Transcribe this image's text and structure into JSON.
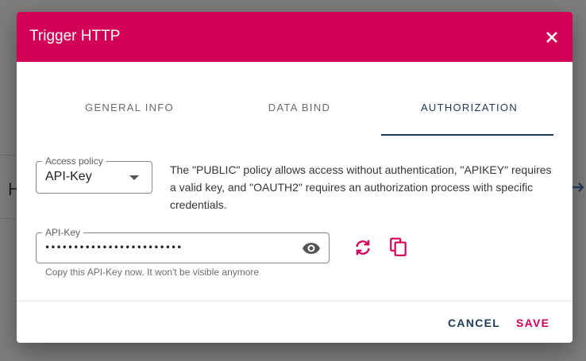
{
  "dialog": {
    "title": "Trigger HTTP"
  },
  "tabs": [
    {
      "label": "GENERAL INFO",
      "active": false
    },
    {
      "label": "DATA BIND",
      "active": false
    },
    {
      "label": "AUTHORIZATION",
      "active": true
    }
  ],
  "access_policy": {
    "label": "Access policy",
    "value": "API-Key",
    "description": "The \"PUBLIC\" policy allows access without authentication, \"APIKEY\" requires a valid key, and \"OAUTH2\" requires an authorization process with specific credentials."
  },
  "api_key": {
    "label": "API-Key",
    "value": "••••••••••••••••••••••••",
    "hint": "Copy this API-Key now. It won't be visible anymore"
  },
  "footer": {
    "cancel_label": "CANCEL",
    "save_label": "SAVE"
  },
  "background": {
    "letter": "H"
  },
  "icons": {
    "close": "close-icon",
    "visibility": "eye-icon",
    "regenerate": "refresh-icon",
    "copy": "copy-icon",
    "dropdown": "caret-down-icon"
  },
  "colors": {
    "header": "#d20057",
    "accent": "#d20057",
    "tab_active": "#1e3a5a",
    "overlay": "#7d7d7d"
  }
}
